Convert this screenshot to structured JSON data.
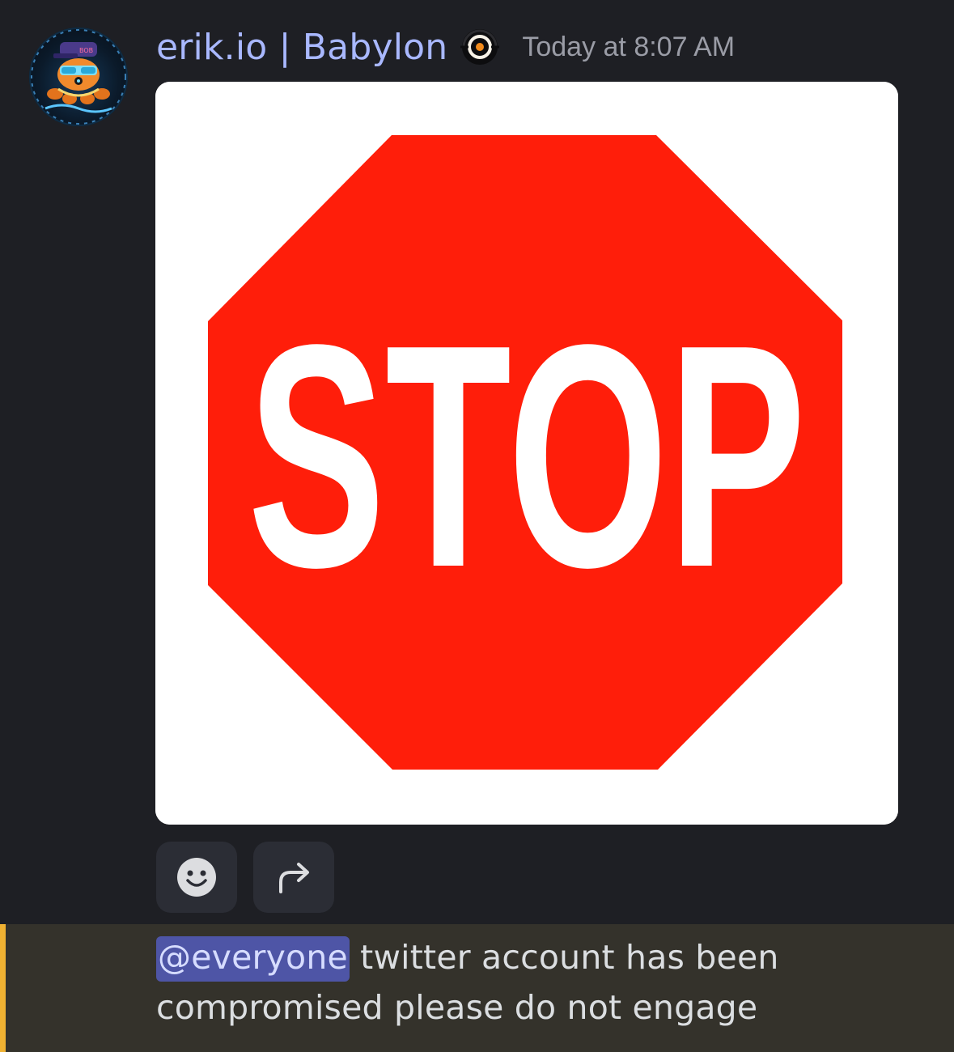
{
  "message": {
    "author": {
      "display_name": "erik.io | Babylon",
      "avatar_icon": "pixel-octopus-avatar-icon",
      "badge_icon": "babylon-server-tag-icon"
    },
    "timestamp": "Today at 8:07 AM",
    "attachment": {
      "sign_text": "STOP"
    },
    "actions": {
      "reaction_icon": "smiley-face-icon",
      "forward_icon": "forward-arrow-icon"
    },
    "body": {
      "mention": "@everyone",
      "text": " twitter account has been compromised please do not engage"
    }
  },
  "colors": {
    "background": "#1e1f24",
    "username": "#a9b8ff",
    "mention_bg": "#4e55a6",
    "highlight_bar": "#34322b",
    "highlight_accent": "#f0b232",
    "stop_red": "#ff1e0a"
  }
}
